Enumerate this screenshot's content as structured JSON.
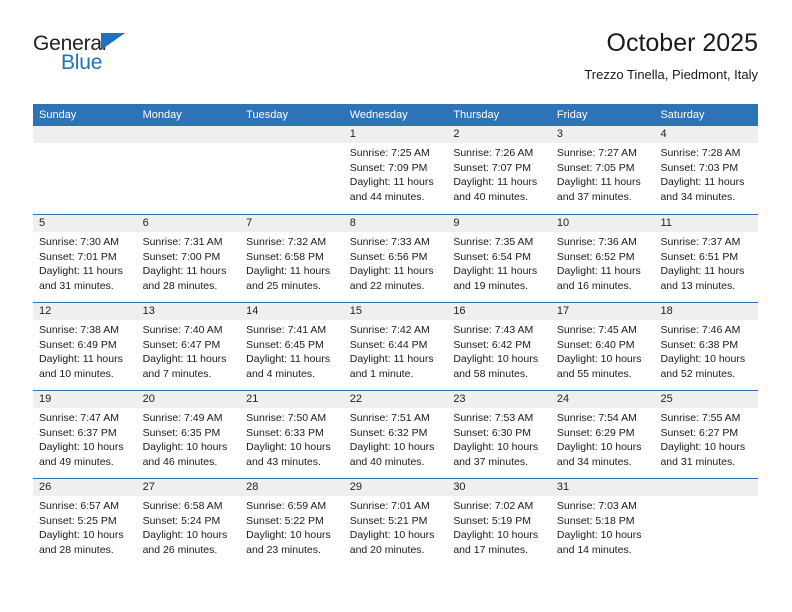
{
  "brand": {
    "name_top": "General",
    "name_bottom": "Blue",
    "accent_color": "#1f72bd"
  },
  "header": {
    "title": "October 2025",
    "subtitle": "Trezzo Tinella, Piedmont, Italy"
  },
  "theme": {
    "header_bar_color": "#2e72b8",
    "day_number_band_color": "#efefef",
    "grid_line_color": "#2e72b8"
  },
  "weekdays": [
    "Sunday",
    "Monday",
    "Tuesday",
    "Wednesday",
    "Thursday",
    "Friday",
    "Saturday"
  ],
  "weeks": [
    [
      {
        "day": "",
        "empty": true
      },
      {
        "day": "",
        "empty": true
      },
      {
        "day": "",
        "empty": true
      },
      {
        "day": "1",
        "sunrise": "Sunrise: 7:25 AM",
        "sunset": "Sunset: 7:09 PM",
        "daylight_1": "Daylight: 11 hours",
        "daylight_2": "and 44 minutes."
      },
      {
        "day": "2",
        "sunrise": "Sunrise: 7:26 AM",
        "sunset": "Sunset: 7:07 PM",
        "daylight_1": "Daylight: 11 hours",
        "daylight_2": "and 40 minutes."
      },
      {
        "day": "3",
        "sunrise": "Sunrise: 7:27 AM",
        "sunset": "Sunset: 7:05 PM",
        "daylight_1": "Daylight: 11 hours",
        "daylight_2": "and 37 minutes."
      },
      {
        "day": "4",
        "sunrise": "Sunrise: 7:28 AM",
        "sunset": "Sunset: 7:03 PM",
        "daylight_1": "Daylight: 11 hours",
        "daylight_2": "and 34 minutes."
      }
    ],
    [
      {
        "day": "5",
        "sunrise": "Sunrise: 7:30 AM",
        "sunset": "Sunset: 7:01 PM",
        "daylight_1": "Daylight: 11 hours",
        "daylight_2": "and 31 minutes."
      },
      {
        "day": "6",
        "sunrise": "Sunrise: 7:31 AM",
        "sunset": "Sunset: 7:00 PM",
        "daylight_1": "Daylight: 11 hours",
        "daylight_2": "and 28 minutes."
      },
      {
        "day": "7",
        "sunrise": "Sunrise: 7:32 AM",
        "sunset": "Sunset: 6:58 PM",
        "daylight_1": "Daylight: 11 hours",
        "daylight_2": "and 25 minutes."
      },
      {
        "day": "8",
        "sunrise": "Sunrise: 7:33 AM",
        "sunset": "Sunset: 6:56 PM",
        "daylight_1": "Daylight: 11 hours",
        "daylight_2": "and 22 minutes."
      },
      {
        "day": "9",
        "sunrise": "Sunrise: 7:35 AM",
        "sunset": "Sunset: 6:54 PM",
        "daylight_1": "Daylight: 11 hours",
        "daylight_2": "and 19 minutes."
      },
      {
        "day": "10",
        "sunrise": "Sunrise: 7:36 AM",
        "sunset": "Sunset: 6:52 PM",
        "daylight_1": "Daylight: 11 hours",
        "daylight_2": "and 16 minutes."
      },
      {
        "day": "11",
        "sunrise": "Sunrise: 7:37 AM",
        "sunset": "Sunset: 6:51 PM",
        "daylight_1": "Daylight: 11 hours",
        "daylight_2": "and 13 minutes."
      }
    ],
    [
      {
        "day": "12",
        "sunrise": "Sunrise: 7:38 AM",
        "sunset": "Sunset: 6:49 PM",
        "daylight_1": "Daylight: 11 hours",
        "daylight_2": "and 10 minutes."
      },
      {
        "day": "13",
        "sunrise": "Sunrise: 7:40 AM",
        "sunset": "Sunset: 6:47 PM",
        "daylight_1": "Daylight: 11 hours",
        "daylight_2": "and 7 minutes."
      },
      {
        "day": "14",
        "sunrise": "Sunrise: 7:41 AM",
        "sunset": "Sunset: 6:45 PM",
        "daylight_1": "Daylight: 11 hours",
        "daylight_2": "and 4 minutes."
      },
      {
        "day": "15",
        "sunrise": "Sunrise: 7:42 AM",
        "sunset": "Sunset: 6:44 PM",
        "daylight_1": "Daylight: 11 hours",
        "daylight_2": "and 1 minute."
      },
      {
        "day": "16",
        "sunrise": "Sunrise: 7:43 AM",
        "sunset": "Sunset: 6:42 PM",
        "daylight_1": "Daylight: 10 hours",
        "daylight_2": "and 58 minutes."
      },
      {
        "day": "17",
        "sunrise": "Sunrise: 7:45 AM",
        "sunset": "Sunset: 6:40 PM",
        "daylight_1": "Daylight: 10 hours",
        "daylight_2": "and 55 minutes."
      },
      {
        "day": "18",
        "sunrise": "Sunrise: 7:46 AM",
        "sunset": "Sunset: 6:38 PM",
        "daylight_1": "Daylight: 10 hours",
        "daylight_2": "and 52 minutes."
      }
    ],
    [
      {
        "day": "19",
        "sunrise": "Sunrise: 7:47 AM",
        "sunset": "Sunset: 6:37 PM",
        "daylight_1": "Daylight: 10 hours",
        "daylight_2": "and 49 minutes."
      },
      {
        "day": "20",
        "sunrise": "Sunrise: 7:49 AM",
        "sunset": "Sunset: 6:35 PM",
        "daylight_1": "Daylight: 10 hours",
        "daylight_2": "and 46 minutes."
      },
      {
        "day": "21",
        "sunrise": "Sunrise: 7:50 AM",
        "sunset": "Sunset: 6:33 PM",
        "daylight_1": "Daylight: 10 hours",
        "daylight_2": "and 43 minutes."
      },
      {
        "day": "22",
        "sunrise": "Sunrise: 7:51 AM",
        "sunset": "Sunset: 6:32 PM",
        "daylight_1": "Daylight: 10 hours",
        "daylight_2": "and 40 minutes."
      },
      {
        "day": "23",
        "sunrise": "Sunrise: 7:53 AM",
        "sunset": "Sunset: 6:30 PM",
        "daylight_1": "Daylight: 10 hours",
        "daylight_2": "and 37 minutes."
      },
      {
        "day": "24",
        "sunrise": "Sunrise: 7:54 AM",
        "sunset": "Sunset: 6:29 PM",
        "daylight_1": "Daylight: 10 hours",
        "daylight_2": "and 34 minutes."
      },
      {
        "day": "25",
        "sunrise": "Sunrise: 7:55 AM",
        "sunset": "Sunset: 6:27 PM",
        "daylight_1": "Daylight: 10 hours",
        "daylight_2": "and 31 minutes."
      }
    ],
    [
      {
        "day": "26",
        "sunrise": "Sunrise: 6:57 AM",
        "sunset": "Sunset: 5:25 PM",
        "daylight_1": "Daylight: 10 hours",
        "daylight_2": "and 28 minutes."
      },
      {
        "day": "27",
        "sunrise": "Sunrise: 6:58 AM",
        "sunset": "Sunset: 5:24 PM",
        "daylight_1": "Daylight: 10 hours",
        "daylight_2": "and 26 minutes."
      },
      {
        "day": "28",
        "sunrise": "Sunrise: 6:59 AM",
        "sunset": "Sunset: 5:22 PM",
        "daylight_1": "Daylight: 10 hours",
        "daylight_2": "and 23 minutes."
      },
      {
        "day": "29",
        "sunrise": "Sunrise: 7:01 AM",
        "sunset": "Sunset: 5:21 PM",
        "daylight_1": "Daylight: 10 hours",
        "daylight_2": "and 20 minutes."
      },
      {
        "day": "30",
        "sunrise": "Sunrise: 7:02 AM",
        "sunset": "Sunset: 5:19 PM",
        "daylight_1": "Daylight: 10 hours",
        "daylight_2": "and 17 minutes."
      },
      {
        "day": "31",
        "sunrise": "Sunrise: 7:03 AM",
        "sunset": "Sunset: 5:18 PM",
        "daylight_1": "Daylight: 10 hours",
        "daylight_2": "and 14 minutes."
      },
      {
        "day": "",
        "empty": true
      }
    ]
  ]
}
